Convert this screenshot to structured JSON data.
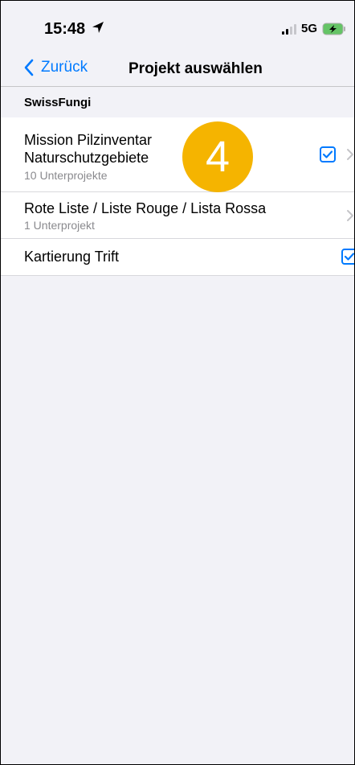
{
  "status_bar": {
    "time": "15:48",
    "network": "5G"
  },
  "nav": {
    "back_label": "Zurück",
    "title": "Projekt auswählen"
  },
  "section": {
    "header": "SwissFungi"
  },
  "rows": [
    {
      "title_line1": "Mission Pilzinventar",
      "title_line2": "Naturschutzgebiete",
      "subtitle": "10 Unterprojekte",
      "checked": true,
      "has_chevron": true
    },
    {
      "title": "Rote Liste / Liste Rouge / Lista Rossa",
      "subtitle": "1 Unterprojekt",
      "checked": false,
      "has_chevron": true
    },
    {
      "title": "Kartierung Trift",
      "checked": true,
      "has_chevron": false
    }
  ],
  "annotation_badge": "4",
  "colors": {
    "accent": "#007aff",
    "badge": "#f5b400",
    "background": "#f2f2f7"
  }
}
